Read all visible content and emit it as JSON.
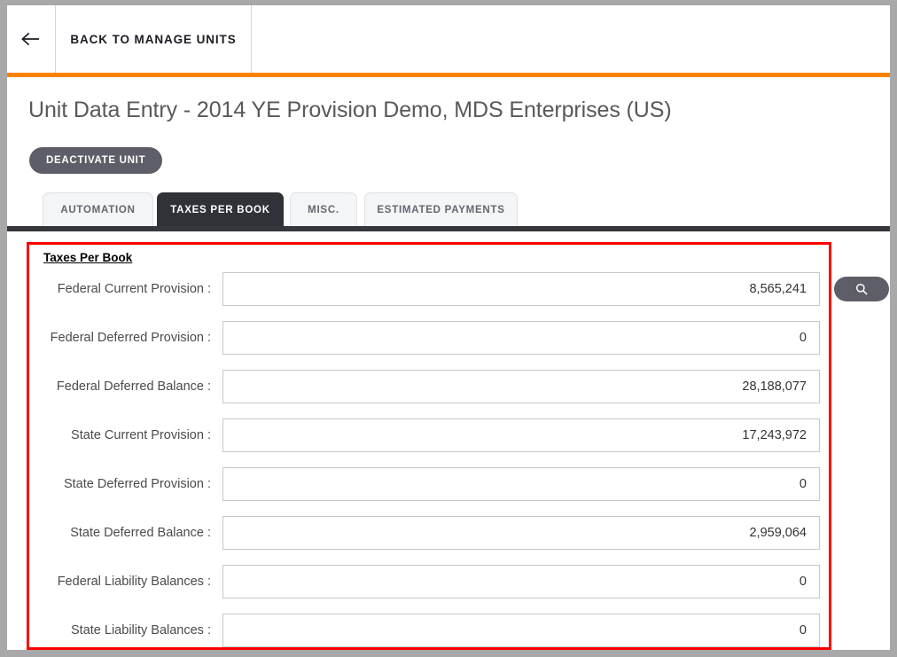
{
  "window": {
    "frame_color": "#a8a8a8"
  },
  "theme": {
    "accent_orange": "#f98300",
    "dark": "#313237",
    "button_gray": "#5d5e67",
    "annotation_red": "#fe0000",
    "title_gray": "#58595b"
  },
  "top_nav": {
    "back_icon": "arrow-left-icon",
    "back_label": "BACK TO MANAGE UNITS"
  },
  "header": {
    "title": "Unit Data Entry - 2014 YE Provision Demo, MDS Enterprises (US)",
    "deactivate_label": "DEACTIVATE UNIT"
  },
  "tabs": [
    {
      "label": "AUTOMATION",
      "active": false
    },
    {
      "label": "TAXES PER BOOK",
      "active": true
    },
    {
      "label": "MISC.",
      "active": false
    },
    {
      "label": "ESTIMATED PAYMENTS",
      "active": false
    }
  ],
  "form": {
    "section_title": "Taxes Per Book",
    "fields": [
      {
        "label": "Federal Current Provision :",
        "value": "8,565,241"
      },
      {
        "label": "Federal Deferred Provision :",
        "value": "0"
      },
      {
        "label": "Federal Deferred Balance :",
        "value": "28,188,077"
      },
      {
        "label": "State Current Provision :",
        "value": "17,243,972"
      },
      {
        "label": "State Deferred Provision :",
        "value": "0"
      },
      {
        "label": "State Deferred Balance :",
        "value": "2,959,064"
      },
      {
        "label": "Federal Liability Balances :",
        "value": "0"
      },
      {
        "label": "State Liability Balances :",
        "value": "0"
      }
    ]
  },
  "search": {
    "icon": "magnifier-icon"
  }
}
